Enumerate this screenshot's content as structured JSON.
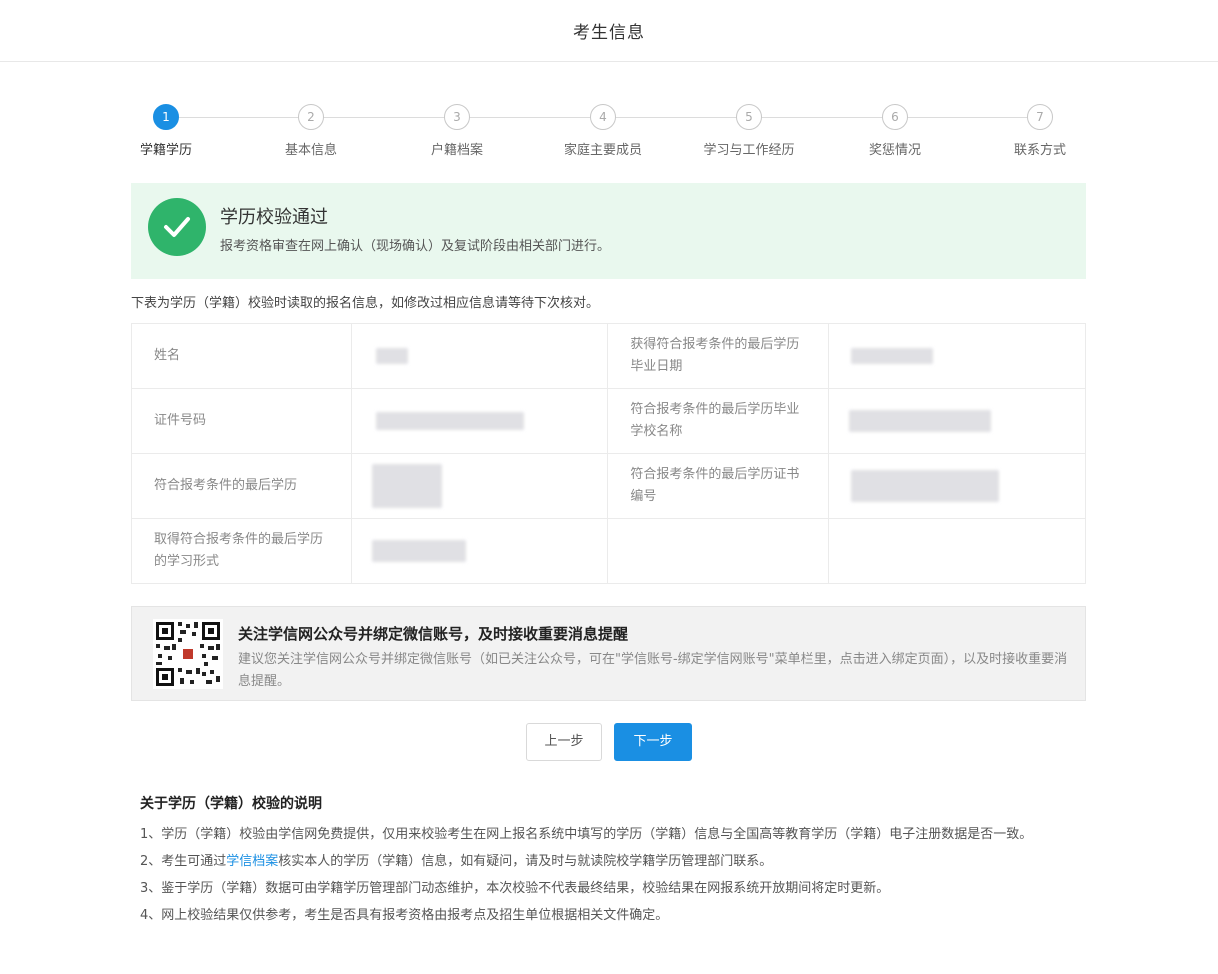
{
  "header": {
    "title": "考生信息"
  },
  "steps": [
    {
      "num": "1",
      "label": "学籍学历",
      "active": true
    },
    {
      "num": "2",
      "label": "基本信息",
      "active": false
    },
    {
      "num": "3",
      "label": "户籍档案",
      "active": false
    },
    {
      "num": "4",
      "label": "家庭主要成员",
      "active": false
    },
    {
      "num": "5",
      "label": "学习与工作经历",
      "active": false
    },
    {
      "num": "6",
      "label": "奖惩情况",
      "active": false
    },
    {
      "num": "7",
      "label": "联系方式",
      "active": false
    }
  ],
  "success": {
    "title": "学历校验通过",
    "subtitle": "报考资格审查在网上确认（现场确认）及复试阶段由相关部门进行。"
  },
  "intro": "下表为学历（学籍）校验时读取的报名信息，如修改过相应信息请等待下次核对。",
  "info_table": {
    "name_label": "姓名",
    "grad_date_label": "获得符合报考条件的最后学历毕业日期",
    "id_label": "证件号码",
    "school_label": "符合报考条件的最后学历毕业学校名称",
    "degree_label": "符合报考条件的最后学历",
    "cert_label": "符合报考条件的最后学历证书编号",
    "study_form_label": "取得符合报考条件的最后学历的学习形式"
  },
  "wechat": {
    "title": "关注学信网公众号并绑定微信账号，及时接收重要消息提醒",
    "text": "建议您关注学信网公众号并绑定微信账号（如已关注公众号，可在\"学信账号-绑定学信网账号\"菜单栏里，点击进入绑定页面），以及时接收重要消息提醒。"
  },
  "buttons": {
    "prev": "上一步",
    "next": "下一步"
  },
  "notes": {
    "title": "关于学历（学籍）校验的说明",
    "item1": "1、学历（学籍）校验由学信网免费提供，仅用来校验考生在网上报名系统中填写的学历（学籍）信息与全国高等教育学历（学籍）电子注册数据是否一致。",
    "item2_prefix": "2、考生可通过",
    "item2_link": "学信档案",
    "item2_suffix": "核实本人的学历（学籍）信息，如有疑问，请及时与就读院校学籍学历管理部门联系。",
    "item3": "3、鉴于学历（学籍）数据可由学籍学历管理部门动态维护，本次校验不代表最终结果，校验结果在网报系统开放期间将定时更新。",
    "item4": "4、网上校验结果仅供参考，考生是否具有报考资格由报考点及招生单位根据相关文件确定。"
  },
  "colors": {
    "primary": "#1a8fe3",
    "success": "#2fb46b",
    "success_bg": "#e9f8ee"
  }
}
